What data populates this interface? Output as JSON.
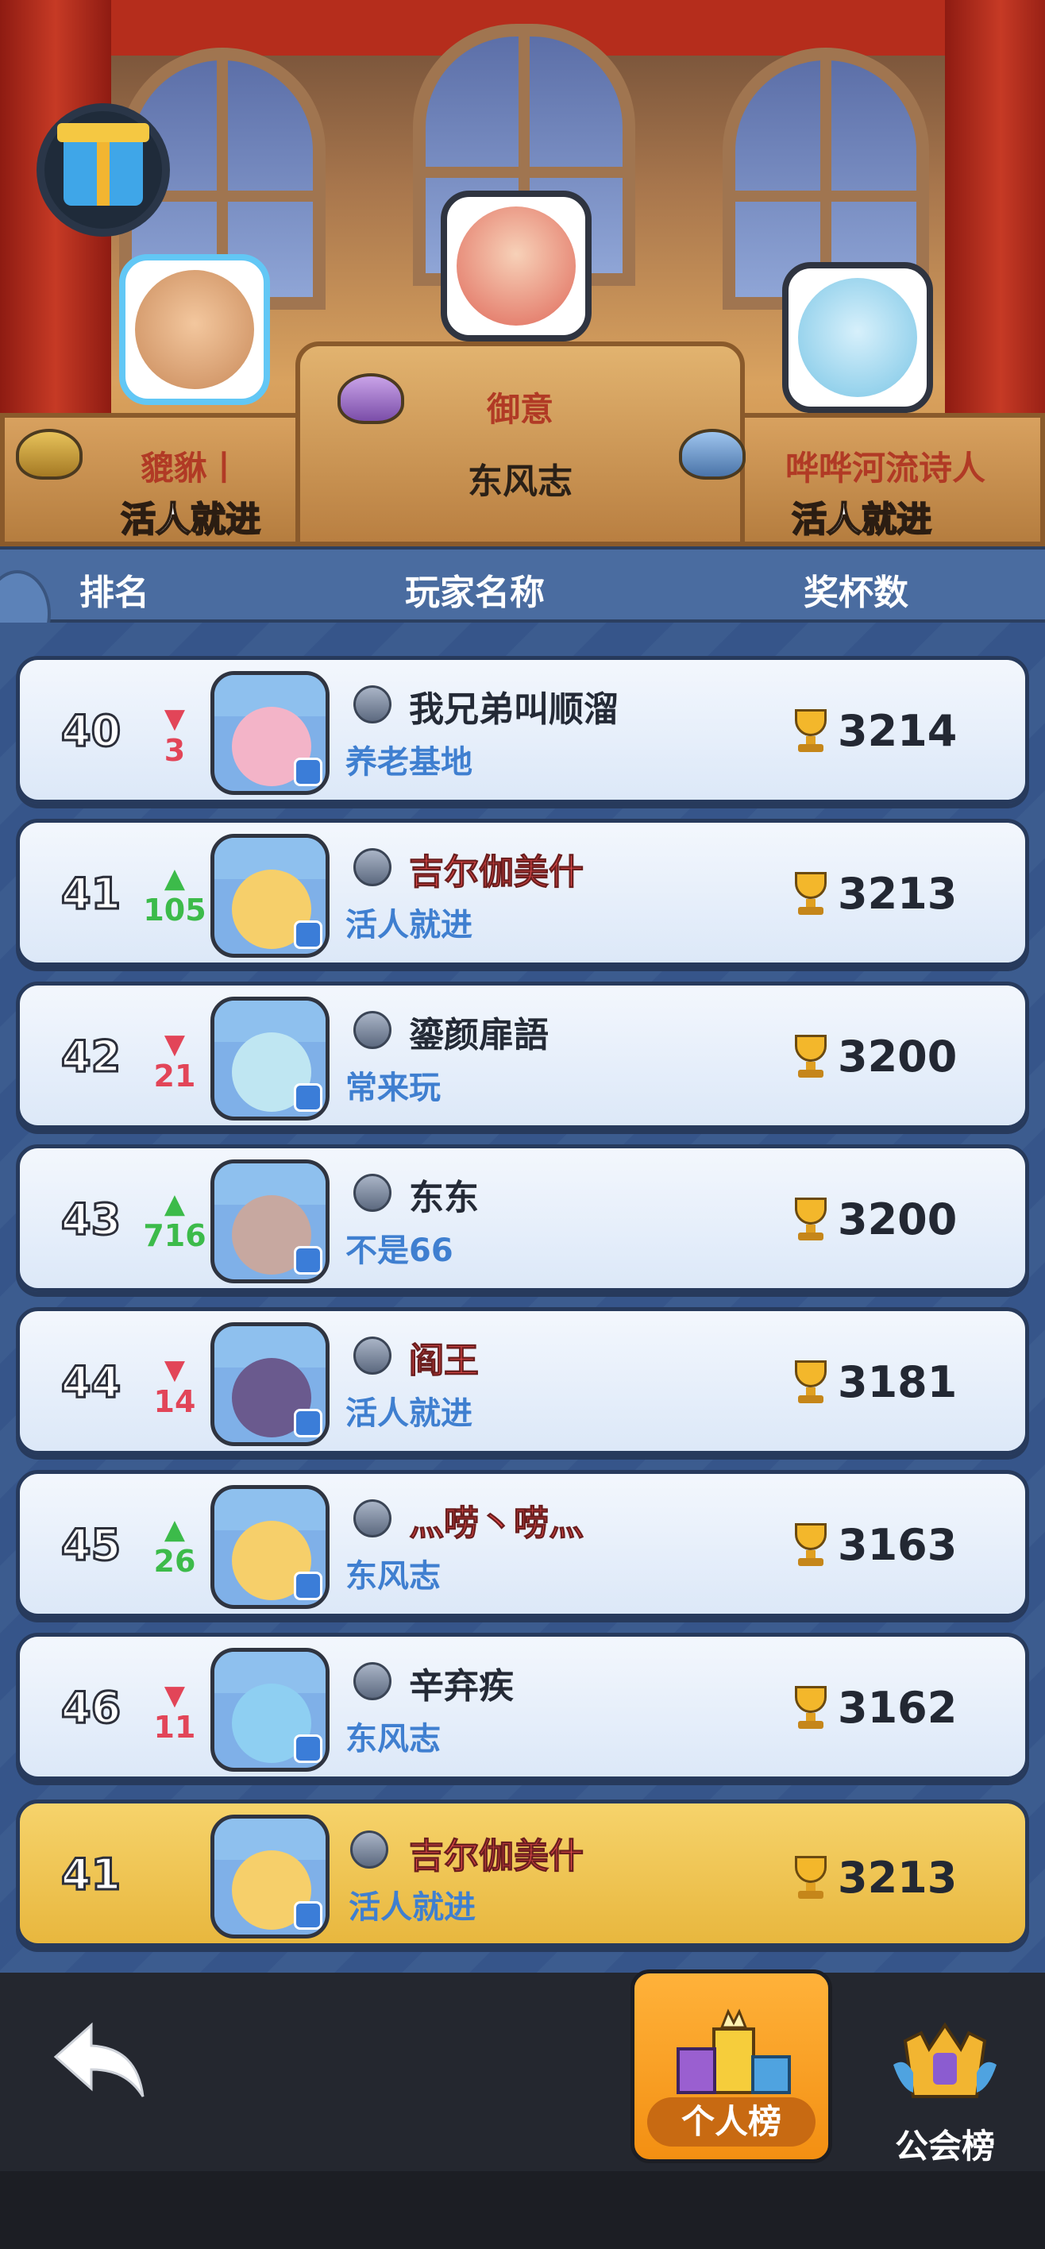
{
  "podium": {
    "first": {
      "player": "御意",
      "guild": "东风志"
    },
    "second": {
      "player": "貔貅丨",
      "guild": "活人就进"
    },
    "third": {
      "player": "哗哗河流诗人",
      "guild": "活人就进"
    }
  },
  "table_header": {
    "rank": "排名",
    "player": "玩家名称",
    "trophies": "奖杯数"
  },
  "rows": [
    {
      "rank": "40",
      "direction": "down",
      "change": "3",
      "player": "我兄弟叫顺溜",
      "player_color": "normal",
      "guild": "养老基地",
      "score": "3214",
      "face_color": "#f3b4c8"
    },
    {
      "rank": "41",
      "direction": "up",
      "change": "105",
      "player": "吉尔伽美什",
      "player_color": "red",
      "guild": "活人就进",
      "score": "3213",
      "face_color": "#f6cf6a"
    },
    {
      "rank": "42",
      "direction": "down",
      "change": "21",
      "player": "鎏颜扉語",
      "player_color": "normal",
      "guild": "常来玩",
      "score": "3200",
      "face_color": "#bfe6f2"
    },
    {
      "rank": "43",
      "direction": "up",
      "change": "716",
      "player": "东东",
      "player_color": "normal",
      "guild": "不是66",
      "score": "3200",
      "face_color": "#c7a8a0"
    },
    {
      "rank": "44",
      "direction": "down",
      "change": "14",
      "player": "阎王",
      "player_color": "red",
      "guild": "活人就进",
      "score": "3181",
      "face_color": "#6a5a8e"
    },
    {
      "rank": "45",
      "direction": "up",
      "change": "26",
      "player": "灬唠丶唠灬",
      "player_color": "red",
      "guild": "东风志",
      "score": "3163",
      "face_color": "#f6cf6a"
    },
    {
      "rank": "46",
      "direction": "down",
      "change": "11",
      "player": "辛弃疾",
      "player_color": "normal",
      "guild": "东风志",
      "score": "3162",
      "face_color": "#8ecff2"
    }
  ],
  "my_row": {
    "rank": "41",
    "player": "吉尔伽美什",
    "guild": "活人就进",
    "score": "3213"
  },
  "arrows": {
    "up": "▲",
    "down": "▼"
  },
  "tabs": {
    "personal": "个人榜",
    "guild": "公会榜"
  },
  "icons": {
    "back": "back-arrow-icon",
    "gift": "gift-icon",
    "trophy": "trophy-icon"
  }
}
